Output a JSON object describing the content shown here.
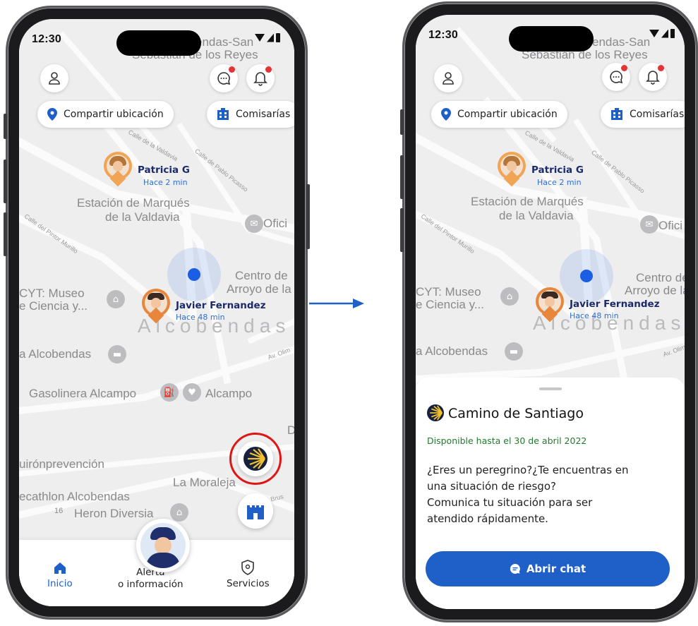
{
  "status_bar": {
    "time": "12:30"
  },
  "map": {
    "labels": {
      "sebastian": "Sebastián de los Reyes",
      "ensanas": "endas-San",
      "estacion_1": "Estación de Marqués",
      "estacion_2": "de la Valdavia",
      "oficina": "Ofici",
      "centro_1": "Centro de",
      "centro_2": "Arroyo de la",
      "cyt_1": "CYT: Museo",
      "cyt_2": "e Ciencia y...",
      "alcobendas_big": "Alcobendas",
      "alcobendas": "a Alcobendas",
      "gasolinera": "Gasolinera Alcampo",
      "alcampo": "Alcampo",
      "quiron": "uirónprevención",
      "moraleja": "La Moraleja",
      "decathlon": "ecathlon Alcobendas",
      "heron": "Heron Diversia",
      "dig": "DIG",
      "street_valdavia": "Calle de la Valdavia",
      "street_picasso": "Calle de Pablo Picasso",
      "street_murillo": "Calle del Pintor Murillo",
      "street_olimpica": "Av. Olim",
      "street_brus": "de Brus"
    }
  },
  "header": {
    "chips": {
      "share_location": "Compartir ubicación",
      "police_stations": "Comisarías"
    }
  },
  "contacts": [
    {
      "name": "Patricia G",
      "time": "Hace 2 min"
    },
    {
      "name": "Javier Fernandez",
      "time": "Hace 48 min"
    }
  ],
  "nav": {
    "home": "Inicio",
    "alert_line1": "Alerta",
    "alert_line2": "o información",
    "services": "Servicios"
  },
  "sheet": {
    "title": "Camino de Santiago",
    "availability": "Disponible hasta el 30 de abril 2022",
    "body_line1": "¿Eres un peregrino?¿Te encuentras en",
    "body_line2": "una situación de riesgo?",
    "body_line3": "Comunica tu situación para ser",
    "body_line4": "atendido rápidamente.",
    "cta": "Abrir chat"
  },
  "colors": {
    "primary_blue": "#1e5fc8",
    "available_green": "#237a2e",
    "highlight_red": "#e01515",
    "marker_orange": "#f0a454"
  },
  "icons": {
    "profile": "user-outline-icon",
    "chat": "chat-bubble-icon",
    "notifications": "bell-icon",
    "location": "location-pin-icon",
    "police": "building-icon",
    "camino": "scallop-shell-icon",
    "castle": "castle-icon",
    "home": "home-icon",
    "services": "shield-icon",
    "send": "message-icon"
  }
}
